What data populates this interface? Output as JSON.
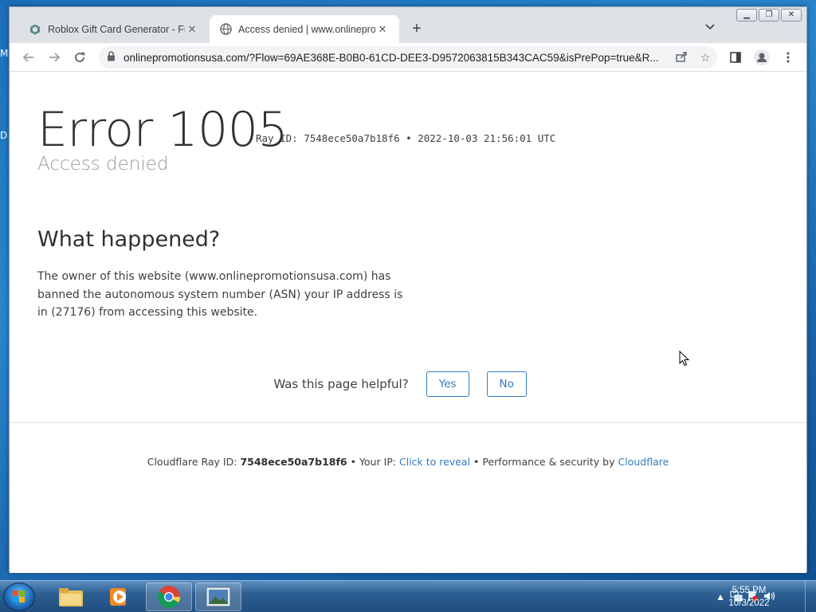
{
  "desktop": {
    "left_glyphs": [
      "M",
      "D"
    ]
  },
  "browser": {
    "tabs": [
      {
        "title": "Roblox Gift Card Generator - Free",
        "active": false
      },
      {
        "title": "Access denied | www.onlinepromotionsusa.com",
        "active": true
      }
    ],
    "window_controls": [
      "minimize",
      "restore",
      "close"
    ],
    "address": "onlinepromotionsusa.com/?Flow=69AE368E-B0B0-61CD-DEE3-D9572063815B343CAC59&isPrePop=true&R..."
  },
  "page": {
    "error_title": "Error 1005",
    "ray_label": "Ray ID: ",
    "ray_id": "7548ece50a7b18f6",
    "ray_sep": " • ",
    "timestamp": "2022-10-03 21:56:01 UTC",
    "subtitle": "Access denied",
    "what_heading": "What happened?",
    "what_text": "The owner of this website (www.onlinepromotionsusa.com) has banned the autonomous system number (ASN) your IP address is in (27176) from accessing this website.",
    "helpful_question": "Was this page helpful?",
    "yes_label": "Yes",
    "no_label": "No",
    "footer": {
      "ray_prefix": "Cloudflare Ray ID: ",
      "ray_id": "7548ece50a7b18f6",
      "ip_prefix": " • Your IP: ",
      "reveal": "Click to reveal",
      "perf_prefix": " • Performance & security by ",
      "brand": "Cloudflare"
    }
  },
  "taskbar": {
    "apps": [
      "windows-explorer",
      "media-player",
      "chrome",
      "photo-viewer"
    ],
    "clock_time": "5:55 PM",
    "clock_date": "10/3/2022"
  },
  "colors": {
    "link": "#2f7bbf",
    "title": "#313131",
    "subtitle": "#999999"
  }
}
